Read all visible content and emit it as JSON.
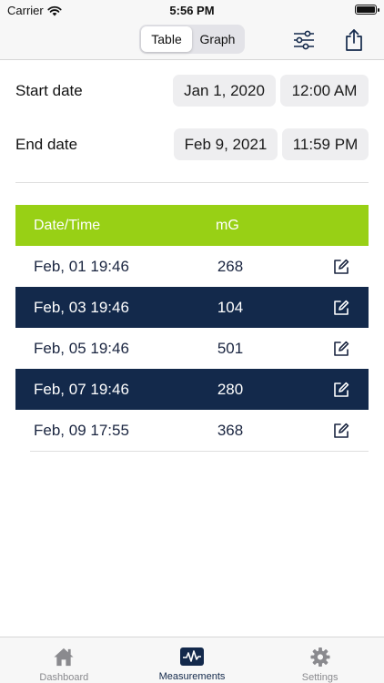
{
  "status_bar": {
    "carrier": "Carrier",
    "time": "5:56 PM"
  },
  "nav": {
    "segments": [
      {
        "label": "Table",
        "active": true
      },
      {
        "label": "Graph",
        "active": false
      }
    ],
    "filter_icon": "sliders-icon",
    "share_icon": "share-icon"
  },
  "filters": {
    "start": {
      "label": "Start date",
      "date": "Jan 1, 2020",
      "time": "12:00 AM"
    },
    "end": {
      "label": "End date",
      "date": "Feb 9, 2021",
      "time": "11:59 PM"
    }
  },
  "table": {
    "header_color": "#98d015",
    "dark_row_color": "#13294b",
    "columns": [
      "Date/Time",
      "mG"
    ],
    "rows": [
      {
        "datetime": "Feb, 01 19:46",
        "value": "268"
      },
      {
        "datetime": "Feb, 03 19:46",
        "value": "104"
      },
      {
        "datetime": "Feb, 05 19:46",
        "value": "501"
      },
      {
        "datetime": "Feb, 07 19:46",
        "value": "280"
      },
      {
        "datetime": "Feb, 09 17:55",
        "value": "368"
      }
    ]
  },
  "tabs": [
    {
      "label": "Dashboard",
      "icon": "house-icon",
      "active": false
    },
    {
      "label": "Measurements",
      "icon": "waveform-icon",
      "active": true
    },
    {
      "label": "Settings",
      "icon": "gear-icon",
      "active": false
    }
  ]
}
